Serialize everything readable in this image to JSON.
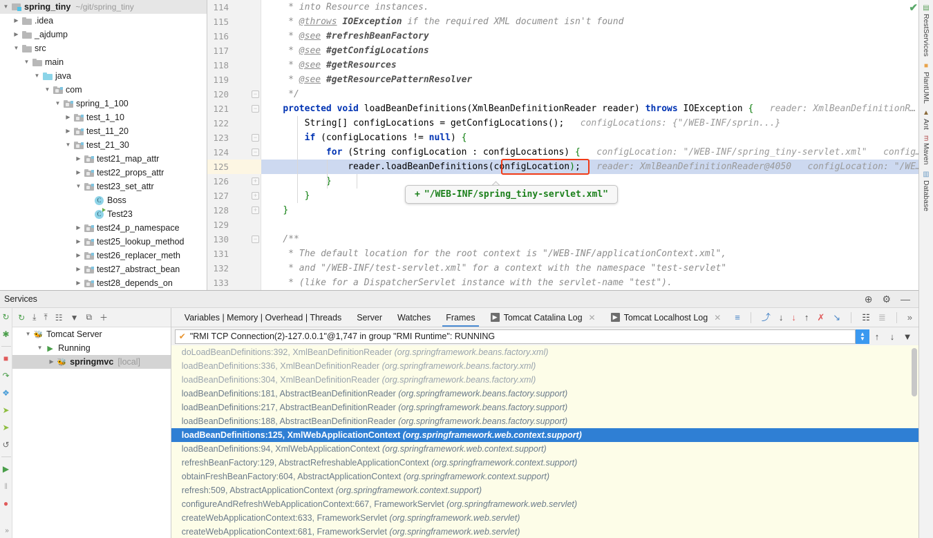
{
  "project": {
    "header": {
      "name": "spring_tiny",
      "path": "~/git/spring_tiny"
    },
    "items": [
      {
        "label": ".idea",
        "depth": 1,
        "state": "closed",
        "icon": "folder-icon"
      },
      {
        "label": "_ajdump",
        "depth": 1,
        "state": "closed",
        "icon": "folder-icon"
      },
      {
        "label": "src",
        "depth": 1,
        "state": "open",
        "icon": "folder-icon"
      },
      {
        "label": "main",
        "depth": 2,
        "state": "open",
        "icon": "folder-icon"
      },
      {
        "label": "java",
        "depth": 3,
        "state": "open",
        "icon": "source-folder-icon"
      },
      {
        "label": "com",
        "depth": 4,
        "state": "open",
        "icon": "package-icon"
      },
      {
        "label": "spring_1_100",
        "depth": 5,
        "state": "open",
        "icon": "package-icon"
      },
      {
        "label": "test_1_10",
        "depth": 6,
        "state": "closed",
        "icon": "package-icon"
      },
      {
        "label": "test_11_20",
        "depth": 6,
        "state": "closed",
        "icon": "package-icon"
      },
      {
        "label": "test_21_30",
        "depth": 6,
        "state": "open",
        "icon": "package-icon"
      },
      {
        "label": "test21_map_attr",
        "depth": 7,
        "state": "closed",
        "icon": "package-icon"
      },
      {
        "label": "test22_props_attr",
        "depth": 7,
        "state": "closed",
        "icon": "package-icon"
      },
      {
        "label": "test23_set_attr",
        "depth": 7,
        "state": "open",
        "icon": "package-icon"
      },
      {
        "label": "Boss",
        "depth": 8,
        "state": "none",
        "icon": "java-class-icon"
      },
      {
        "label": "Test23",
        "depth": 8,
        "state": "none",
        "icon": "java-class-runnable-icon"
      },
      {
        "label": "test24_p_namespace",
        "depth": 7,
        "state": "closed",
        "icon": "package-icon"
      },
      {
        "label": "test25_lookup_method",
        "depth": 7,
        "state": "closed",
        "icon": "package-icon"
      },
      {
        "label": "test26_replacer_meth",
        "depth": 7,
        "state": "closed",
        "icon": "package-icon"
      },
      {
        "label": "test27_abstract_bean",
        "depth": 7,
        "state": "closed",
        "icon": "package-icon"
      },
      {
        "label": "test28_depends_on",
        "depth": 7,
        "state": "closed",
        "icon": "package-icon"
      }
    ]
  },
  "editor": {
    "first_line": 114,
    "last_line": 133,
    "highlighted_line": 125,
    "lines": [
      {
        "n": 114,
        "segments": [
          {
            "t": "     * into Resource instances.",
            "c": "cmt"
          }
        ]
      },
      {
        "n": 115,
        "segments": [
          {
            "t": "     * ",
            "c": "cmt"
          },
          {
            "t": "@throws",
            "c": "cmt-tag"
          },
          {
            "t": " ",
            "c": "cmt"
          },
          {
            "t": "IOException",
            "c": "cmt-bold"
          },
          {
            "t": " if the required XML document isn't found",
            "c": "cmt"
          }
        ]
      },
      {
        "n": 116,
        "segments": [
          {
            "t": "     * ",
            "c": "cmt"
          },
          {
            "t": "@see",
            "c": "cmt-tag"
          },
          {
            "t": " ",
            "c": "cmt"
          },
          {
            "t": "#refreshBeanFactory",
            "c": "cmt-bold"
          }
        ]
      },
      {
        "n": 117,
        "segments": [
          {
            "t": "     * ",
            "c": "cmt"
          },
          {
            "t": "@see",
            "c": "cmt-tag"
          },
          {
            "t": " ",
            "c": "cmt"
          },
          {
            "t": "#getConfigLocations",
            "c": "cmt-bold"
          }
        ]
      },
      {
        "n": 118,
        "segments": [
          {
            "t": "     * ",
            "c": "cmt"
          },
          {
            "t": "@see",
            "c": "cmt-tag"
          },
          {
            "t": " ",
            "c": "cmt"
          },
          {
            "t": "#getResources",
            "c": "cmt-bold"
          }
        ]
      },
      {
        "n": 119,
        "segments": [
          {
            "t": "     * ",
            "c": "cmt"
          },
          {
            "t": "@see",
            "c": "cmt-tag"
          },
          {
            "t": " ",
            "c": "cmt"
          },
          {
            "t": "#getResourcePatternResolver",
            "c": "cmt-bold"
          }
        ]
      },
      {
        "n": 120,
        "segments": [
          {
            "t": "     */",
            "c": "cmt"
          }
        ]
      },
      {
        "n": 121,
        "segments": [
          {
            "t": "    ",
            "c": ""
          },
          {
            "t": "protected void",
            "c": "kw"
          },
          {
            "t": " loadBeanDefinitions(XmlBeanDefinitionReader reader) ",
            "c": ""
          },
          {
            "t": "throws",
            "c": "kw"
          },
          {
            "t": " IOException ",
            "c": ""
          },
          {
            "t": "{",
            "c": "brace-g"
          },
          {
            "t": "   reader: XmlBeanDefinitionR…",
            "c": "hint"
          }
        ]
      },
      {
        "n": 122,
        "segments": [
          {
            "t": "        String[] configLocations = getConfigLocations();",
            "c": ""
          },
          {
            "t": "   configLocations: {\"/WEB-INF/sprin...}",
            "c": "hint"
          }
        ]
      },
      {
        "n": 123,
        "segments": [
          {
            "t": "        ",
            "c": ""
          },
          {
            "t": "if",
            "c": "kw"
          },
          {
            "t": " (configLocations != ",
            "c": ""
          },
          {
            "t": "null",
            "c": "kw"
          },
          {
            "t": ") ",
            "c": ""
          },
          {
            "t": "{",
            "c": "brace-g"
          }
        ]
      },
      {
        "n": 124,
        "segments": [
          {
            "t": "            ",
            "c": ""
          },
          {
            "t": "for",
            "c": "kw"
          },
          {
            "t": " (String configLocation : configLocations) ",
            "c": ""
          },
          {
            "t": "{",
            "c": "brace-g"
          },
          {
            "t": "   configLocation: \"/WEB-INF/spring_tiny-servlet.xml\"   config…",
            "c": "hint"
          }
        ]
      },
      {
        "n": 125,
        "segments": [
          {
            "t": "                reader.loadBeanDefinitions(configLocation",
            "c": ""
          },
          {
            "t": ")",
            "c": "brace-g"
          },
          {
            "t": ";",
            "c": ""
          },
          {
            "t": "   reader: XmlBeanDefinitionReader@4050   configLocation: \"/WE…",
            "c": "hint"
          }
        ]
      },
      {
        "n": 126,
        "segments": [
          {
            "t": "            ",
            "c": ""
          },
          {
            "t": "}",
            "c": "brace-g"
          }
        ]
      },
      {
        "n": 127,
        "segments": [
          {
            "t": "        ",
            "c": ""
          },
          {
            "t": "}",
            "c": "brace-g"
          }
        ]
      },
      {
        "n": 128,
        "segments": [
          {
            "t": "    ",
            "c": ""
          },
          {
            "t": "}",
            "c": "brace-g"
          }
        ]
      },
      {
        "n": 129,
        "segments": [
          {
            "t": "",
            "c": ""
          }
        ]
      },
      {
        "n": 130,
        "segments": [
          {
            "t": "    /**",
            "c": "cmt"
          }
        ]
      },
      {
        "n": 131,
        "segments": [
          {
            "t": "     * The default location for the root context is \"/WEB-INF/applicationContext.xml\",",
            "c": "cmt"
          }
        ]
      },
      {
        "n": 132,
        "segments": [
          {
            "t": "     * and \"/WEB-INF/test-servlet.xml\" for a context with the namespace \"test-servlet\"",
            "c": "cmt"
          }
        ]
      },
      {
        "n": 133,
        "segments": [
          {
            "t": "     * (like for a DispatcherServlet instance with the servlet-name \"test\").",
            "c": "cmt"
          }
        ]
      }
    ],
    "tooltip": {
      "plus": "+",
      "value": "\"/WEB-INF/spring_tiny-servlet.xml\""
    },
    "error_highlight_text": "configLocation);",
    "inspection_status": "✔"
  },
  "right_strip": [
    {
      "label": "RestServices",
      "icon": "rest-services-icon"
    },
    {
      "label": "PlantUML",
      "icon": "plantuml-icon"
    },
    {
      "label": "Ant",
      "icon": "ant-icon"
    },
    {
      "label": "Maven",
      "icon": "maven-icon"
    },
    {
      "label": "Database",
      "icon": "database-icon"
    }
  ],
  "services": {
    "title": "Services",
    "title_icons": [
      {
        "name": "help-icon",
        "glyph": "⊕"
      },
      {
        "name": "settings-gear-icon",
        "glyph": "⚙"
      },
      {
        "name": "minimize-icon",
        "glyph": "—"
      }
    ],
    "left_vtoolbar": [
      {
        "name": "rerun-icon",
        "glyph": "↻",
        "color": "#4a9e4a"
      },
      {
        "name": "debug-icon",
        "glyph": "✱",
        "color": "#4a9e4a"
      },
      {
        "name": "stop-icon",
        "glyph": "■",
        "color": "#e05b5b"
      },
      {
        "name": "step-over-icon",
        "glyph": "↷",
        "color": "#4a9e4a"
      },
      {
        "name": "step-into-icon",
        "glyph": "❖",
        "color": "#4a9ed8"
      },
      {
        "name": "force-step-into-icon",
        "glyph": "➤",
        "color": "#8dbd3f"
      },
      {
        "name": "step-out-icon",
        "glyph": "➤",
        "color": "#8dbd3f"
      },
      {
        "name": "rerun-failed-icon",
        "glyph": "↺",
        "color": "#6a6a6a"
      },
      {
        "name": "resume-program-icon",
        "glyph": "▶",
        "color": "#4a9e4a"
      },
      {
        "name": "pause-program-icon",
        "glyph": "‖",
        "color": "#b0b0b0"
      },
      {
        "name": "mute-breakpoints-icon",
        "glyph": "●",
        "color": "#e05b5b"
      }
    ],
    "tree_toolbar": [
      {
        "name": "rerun-service-icon",
        "glyph": "↻"
      },
      {
        "name": "expand-all-icon",
        "glyph": "⤓"
      },
      {
        "name": "collapse-all-icon",
        "glyph": "⤒"
      },
      {
        "name": "group-by-icon",
        "glyph": "☷"
      },
      {
        "name": "filter-icon",
        "glyph": "▼"
      },
      {
        "name": "show-tabs-icon",
        "glyph": "⧉"
      },
      {
        "name": "add-icon",
        "glyph": "＋"
      }
    ],
    "tree": [
      {
        "label": "Tomcat Server",
        "suffix": "",
        "depth": 0,
        "state": "open",
        "icon": "tomcat-icon",
        "selected": false,
        "bold": false
      },
      {
        "label": "Running",
        "suffix": "",
        "depth": 1,
        "state": "open",
        "icon": "running-icon",
        "selected": false,
        "bold": false
      },
      {
        "label": "springmvc",
        "suffix": "[local]",
        "depth": 2,
        "state": "closed",
        "icon": "tomcat-icon",
        "selected": true,
        "bold": true
      }
    ],
    "debug_tabs": [
      {
        "label": "Variables | Memory | Overhead | Threads",
        "active": false,
        "badge": null,
        "closable": false
      },
      {
        "label": "Server",
        "active": false,
        "badge": null,
        "closable": false
      },
      {
        "label": "Watches",
        "active": false,
        "badge": null,
        "closable": false
      },
      {
        "label": "Frames",
        "active": true,
        "badge": null,
        "closable": false
      },
      {
        "label": "Tomcat Catalina Log",
        "active": false,
        "badge": "▶",
        "closable": true
      },
      {
        "label": "Tomcat Localhost Log",
        "active": false,
        "badge": "▶",
        "closable": true
      }
    ],
    "debug_tab_icons": [
      {
        "name": "soft-wrap-icon",
        "glyph": "≡",
        "color": "#4a86c7"
      },
      {
        "name": "show-executing-icon",
        "glyph": "⤴",
        "color": "#4a86c7"
      },
      {
        "name": "scroll-to-end-icon",
        "glyph": "↓",
        "color": "#4a4a4a"
      },
      {
        "name": "scroll-to-bottom-icon",
        "glyph": "↓",
        "color": "#e05b5b"
      },
      {
        "name": "scroll-to-top-icon",
        "glyph": "↑",
        "color": "#4a4a4a"
      },
      {
        "name": "clear-all-icon",
        "glyph": "✗",
        "color": "#e05b5b"
      },
      {
        "name": "scroll-end-cursor-icon",
        "glyph": "↘",
        "color": "#4a86c7"
      },
      {
        "name": "table-view-icon",
        "glyph": "☷",
        "color": "#4a4a4a"
      },
      {
        "name": "settings-list-icon",
        "glyph": "≣",
        "color": "#b0b0b0"
      },
      {
        "name": "more-tabs-icon",
        "glyph": "»",
        "color": "#6a6a6a"
      }
    ],
    "thread": {
      "check": "✔",
      "text": "\"RMI TCP Connection(2)-127.0.0.1\"@1,747 in group \"RMI Runtime\": RUNNING",
      "combo_glyph": "⬍",
      "buttons": [
        {
          "name": "previous-frame-button",
          "glyph": "↑"
        },
        {
          "name": "next-frame-button",
          "glyph": "↓"
        },
        {
          "name": "filter-frames-button",
          "glyph": "▼"
        }
      ]
    },
    "frames": [
      {
        "method": "doLoadBeanDefinitions:392, XmlBeanDefinitionReader",
        "pkg": "(org.springframework.beans.factory.xml)",
        "selected": false,
        "gray": true
      },
      {
        "method": "loadBeanDefinitions:336, XmlBeanDefinitionReader",
        "pkg": "(org.springframework.beans.factory.xml)",
        "selected": false,
        "gray": true
      },
      {
        "method": "loadBeanDefinitions:304, XmlBeanDefinitionReader",
        "pkg": "(org.springframework.beans.factory.xml)",
        "selected": false,
        "gray": true
      },
      {
        "method": "loadBeanDefinitions:181, AbstractBeanDefinitionReader",
        "pkg": "(org.springframework.beans.factory.support)",
        "selected": false,
        "gray": false
      },
      {
        "method": "loadBeanDefinitions:217, AbstractBeanDefinitionReader",
        "pkg": "(org.springframework.beans.factory.support)",
        "selected": false,
        "gray": false
      },
      {
        "method": "loadBeanDefinitions:188, AbstractBeanDefinitionReader",
        "pkg": "(org.springframework.beans.factory.support)",
        "selected": false,
        "gray": false
      },
      {
        "method": "loadBeanDefinitions:125, XmlWebApplicationContext",
        "pkg": "(org.springframework.web.context.support)",
        "selected": true,
        "gray": false
      },
      {
        "method": "loadBeanDefinitions:94, XmlWebApplicationContext",
        "pkg": "(org.springframework.web.context.support)",
        "selected": false,
        "gray": false
      },
      {
        "method": "refreshBeanFactory:129, AbstractRefreshableApplicationContext",
        "pkg": "(org.springframework.context.support)",
        "selected": false,
        "gray": false
      },
      {
        "method": "obtainFreshBeanFactory:604, AbstractApplicationContext",
        "pkg": "(org.springframework.context.support)",
        "selected": false,
        "gray": false
      },
      {
        "method": "refresh:509, AbstractApplicationContext",
        "pkg": "(org.springframework.context.support)",
        "selected": false,
        "gray": false
      },
      {
        "method": "configureAndRefreshWebApplicationContext:667, FrameworkServlet",
        "pkg": "(org.springframework.web.servlet)",
        "selected": false,
        "gray": false
      },
      {
        "method": "createWebApplicationContext:633, FrameworkServlet",
        "pkg": "(org.springframework.web.servlet)",
        "selected": false,
        "gray": false
      },
      {
        "method": "createWebApplicationContext:681, FrameworkServlet",
        "pkg": "(org.springframework.web.servlet)",
        "selected": false,
        "gray": false
      }
    ],
    "collapse_strip_glyph": "»"
  },
  "colors": {
    "selection_blue": "#2f7fd4",
    "highlight_line": "#cdd9f0",
    "gutter_highlight": "#fdf6e3",
    "frames_bg": "#fdfde8",
    "error_red": "#f03a17",
    "string_green": "#1a7f1a",
    "keyword_blue": "#0033b3"
  }
}
